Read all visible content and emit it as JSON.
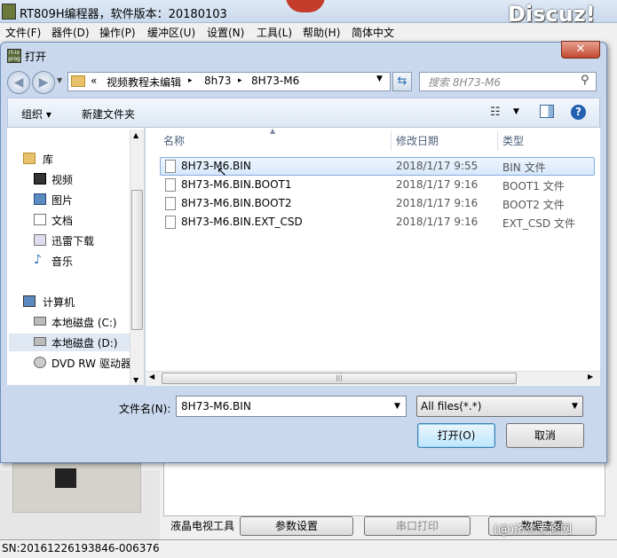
{
  "app": {
    "title": "RT809H编程器，软件版本：20180103",
    "watermark": "Discuz!",
    "menu": [
      "文件(F)",
      "器件(D)",
      "操作(P)",
      "缓冲区(U)",
      "设置(N)",
      "工具(L)",
      "帮助(H)",
      "简体中文"
    ],
    "bottom_label": "液晶电视工具",
    "buttons": [
      "参数设置",
      "串口打印",
      "数据查看"
    ],
    "serial": "SN:20161226193846-006376",
    "wechat_watermark": "(@)济炎爱修网"
  },
  "dialog": {
    "icon_text": "rt-ix prog",
    "title": "打开",
    "close": "✕",
    "address": {
      "prefix": "«",
      "crumbs": [
        "视频教程未编辑",
        "8h73",
        "8H73-M6"
      ],
      "separator": "▸"
    },
    "search_placeholder": "搜索 8H73-M6",
    "toolbar": {
      "organize": "组织 ▾",
      "new_folder": "新建文件夹"
    },
    "nav": [
      {
        "label": "库",
        "icon": "library-icon"
      },
      {
        "label": "视频",
        "icon": "video-icon"
      },
      {
        "label": "图片",
        "icon": "picture-icon"
      },
      {
        "label": "文档",
        "icon": "document-icon"
      },
      {
        "label": "迅雷下载",
        "icon": "download-icon"
      },
      {
        "label": "音乐",
        "icon": "music-icon"
      },
      {
        "label": "计算机",
        "icon": "computer-icon"
      },
      {
        "label": "本地磁盘 (C:)",
        "icon": "drive-icon"
      },
      {
        "label": "本地磁盘 (D:)",
        "icon": "drive-icon"
      },
      {
        "label": "DVD RW 驱动器",
        "icon": "dvd-icon"
      }
    ],
    "columns": {
      "name": "名称",
      "date": "修改日期",
      "type": "类型"
    },
    "files": [
      {
        "name": "8H73-M6.BIN",
        "date": "2018/1/17 9:55",
        "type": "BIN 文件"
      },
      {
        "name": "8H73-M6.BIN.BOOT1",
        "date": "2018/1/17 9:16",
        "type": "BOOT1 文件"
      },
      {
        "name": "8H73-M6.BIN.BOOT2",
        "date": "2018/1/17 9:16",
        "type": "BOOT2 文件"
      },
      {
        "name": "8H73-M6.BIN.EXT_CSD",
        "date": "2018/1/17 9:16",
        "type": "EXT_CSD 文件"
      }
    ],
    "filename_label": "文件名(N):",
    "filename_value": "8H73-M6.BIN",
    "filter_value": "All files(*.*)",
    "open_label": "打开(O)",
    "cancel_label": "取消"
  }
}
